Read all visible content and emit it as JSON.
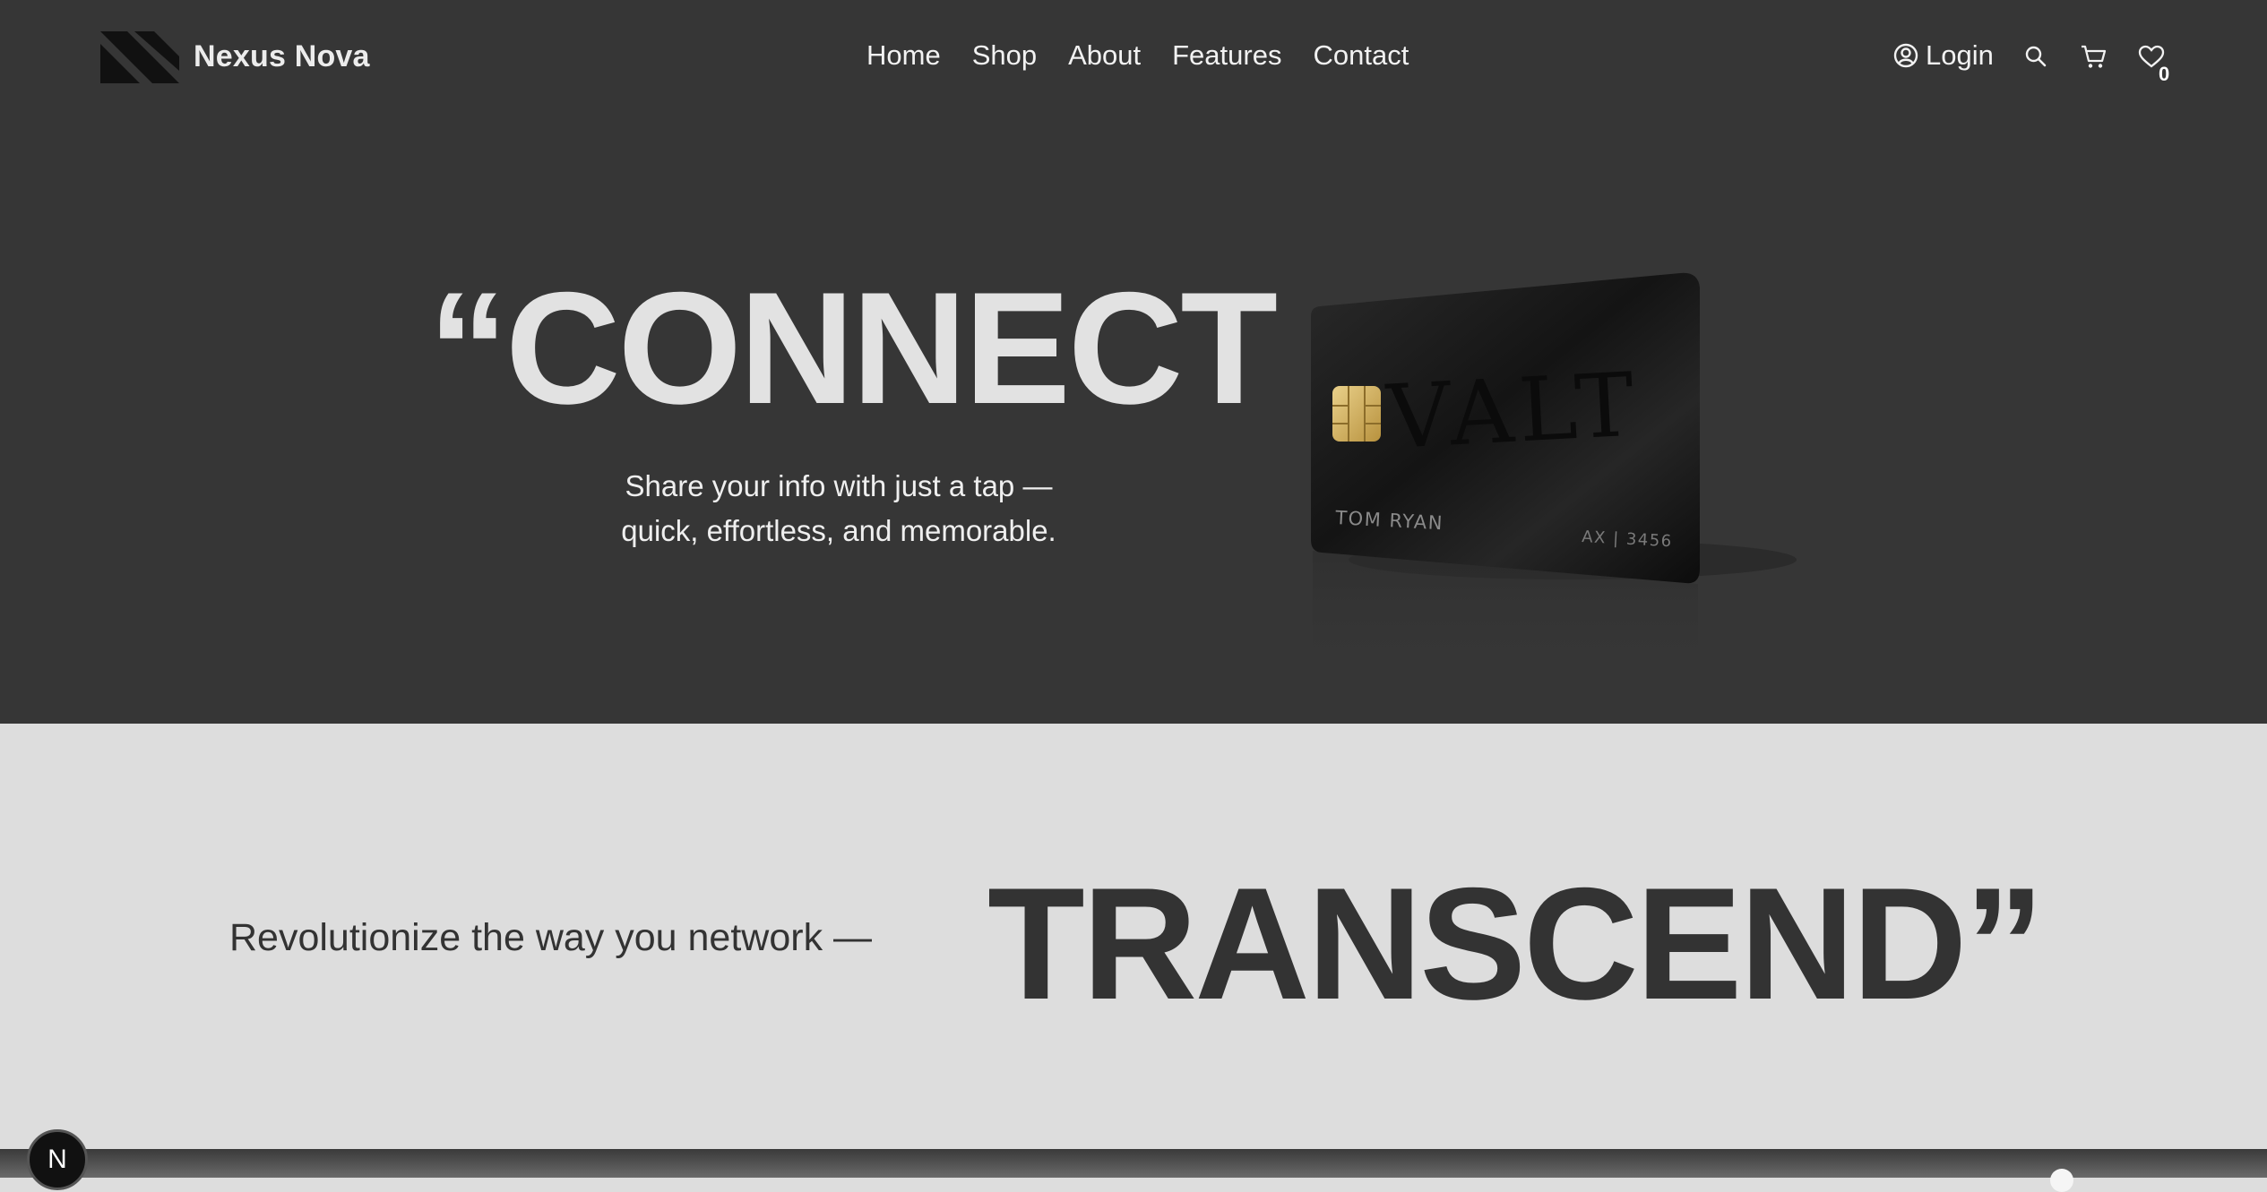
{
  "header": {
    "brand": "Nexus Nova",
    "nav": [
      "Home",
      "Shop",
      "About",
      "Features",
      "Contact"
    ],
    "login_label": "Login",
    "wishlist_count": "0",
    "icons": [
      "user-circle-icon",
      "search-icon",
      "cart-icon",
      "heart-icon"
    ]
  },
  "hero": {
    "headline": "“CONNECT",
    "subtitle_line1": "Share your info with just a tap —",
    "subtitle_line2": "quick, effortless, and memorable.",
    "card": {
      "brand_text": "VALT",
      "name": "TOM RYAN",
      "number": "AX | 3456"
    }
  },
  "band": {
    "tagline": "Revolutionize the way you network —",
    "headline": "TRANSCEND”"
  },
  "dev_badge": "N",
  "colors": {
    "hero_bg": "#363636",
    "band_bg": "#dddddd",
    "hero_text": "#e2e2e2",
    "band_text": "#333333"
  }
}
